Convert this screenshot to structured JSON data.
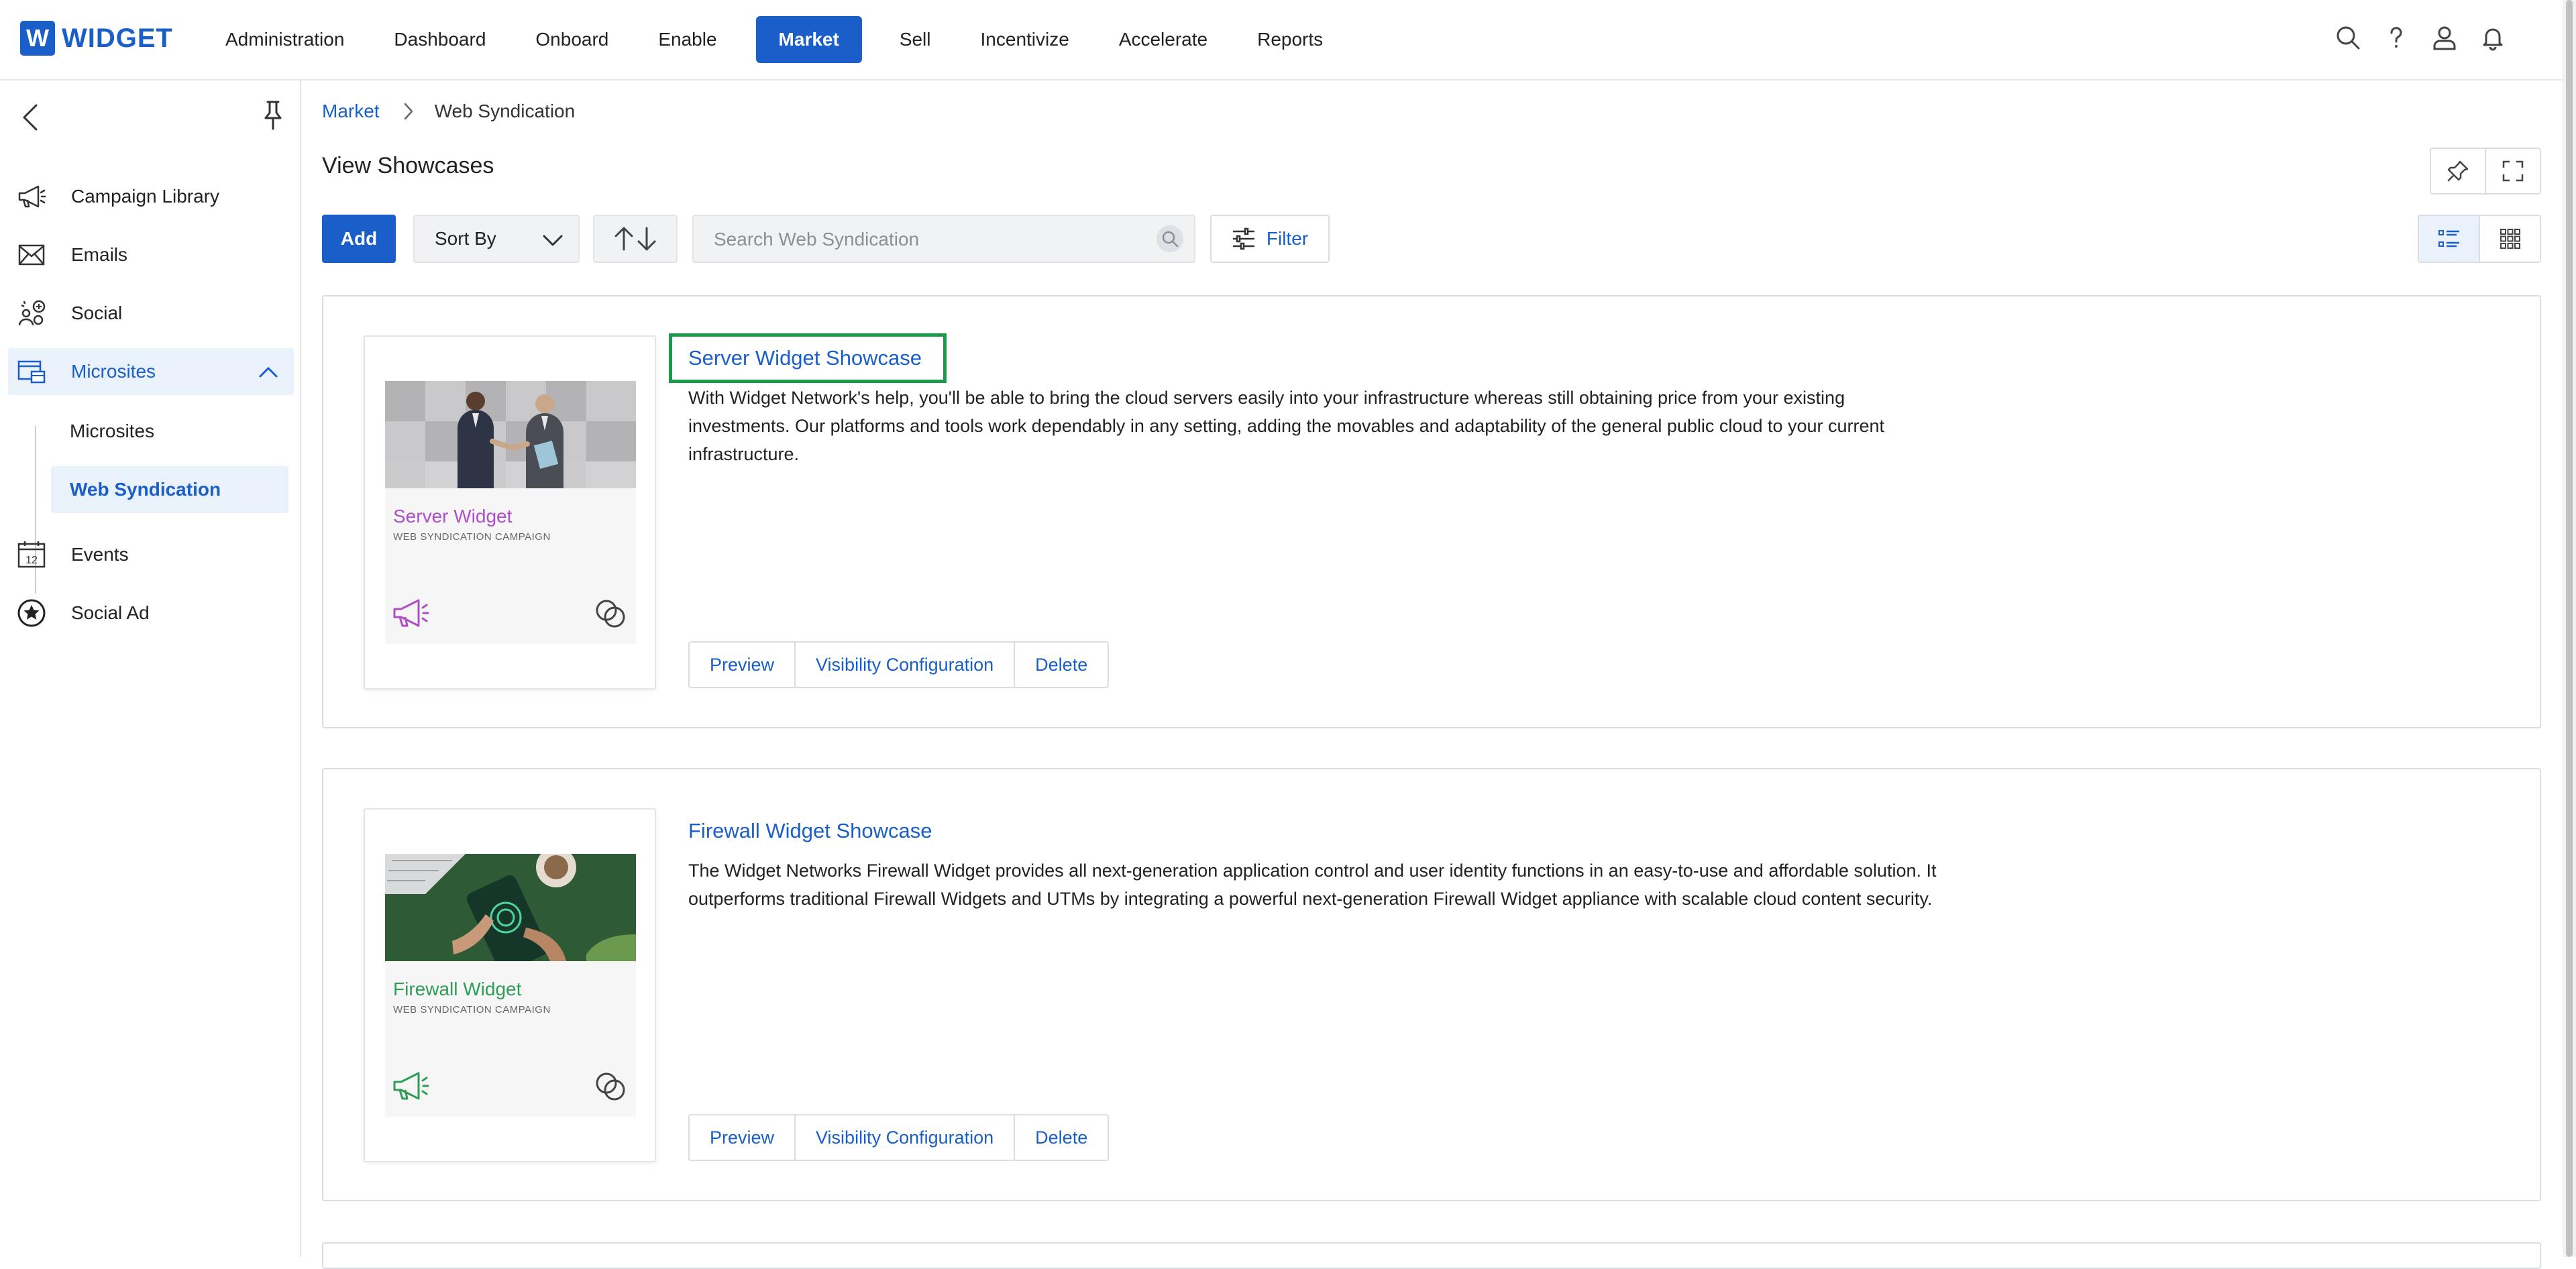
{
  "brand": {
    "logo_letter": "W",
    "name": "WIDGET",
    "accent": "#1a5fc9"
  },
  "nav": {
    "items": [
      {
        "label": "Administration"
      },
      {
        "label": "Dashboard"
      },
      {
        "label": "Onboard"
      },
      {
        "label": "Enable"
      },
      {
        "label": "Market",
        "active": true
      },
      {
        "label": "Sell"
      },
      {
        "label": "Incentivize"
      },
      {
        "label": "Accelerate"
      },
      {
        "label": "Reports"
      }
    ],
    "icons": [
      "search-icon",
      "help-icon",
      "user-icon",
      "bell-icon"
    ]
  },
  "sidebar": {
    "items": [
      {
        "label": "Campaign Library",
        "icon": "megaphone-icon"
      },
      {
        "label": "Emails",
        "icon": "envelope-icon"
      },
      {
        "label": "Social",
        "icon": "social-icon"
      },
      {
        "label": "Microsites",
        "icon": "microsite-icon",
        "expanded": true
      },
      {
        "label": "Events",
        "icon": "calendar-icon"
      },
      {
        "label": "Social Ad",
        "icon": "star-badge-icon"
      }
    ],
    "microsites_sub": [
      {
        "label": "Microsites"
      },
      {
        "label": "Web Syndication",
        "active": true
      }
    ]
  },
  "breadcrumb": {
    "parent": "Market",
    "current": "Web Syndication"
  },
  "page": {
    "title": "View Showcases"
  },
  "toolbar": {
    "add_label": "Add",
    "sort_label": "Sort By",
    "search_placeholder": "Search Web Syndication",
    "filter_label": "Filter"
  },
  "showcases": [
    {
      "title": "Server Widget Showcase",
      "description": "With Widget Network's help, you'll be able to bring the cloud servers easily into your infrastructure whereas still obtaining price from your existing investments. Our platforms and tools work dependably in any setting, adding the movables and adaptability of the general public cloud to your current infrastructure.",
      "thumb_name": "Server Widget",
      "thumb_sub": "WEB SYNDICATION CAMPAIGN",
      "thumb_color": "#b04ec9",
      "highlighted": true,
      "actions": [
        "Preview",
        "Visibility Configuration",
        "Delete"
      ]
    },
    {
      "title": "Firewall Widget Showcase",
      "description": "The Widget Networks Firewall Widget provides all next-generation application control and user identity functions in an easy-to-use and affordable solution. It outperforms traditional Firewall Widgets and UTMs by integrating a powerful next-generation Firewall Widget appliance with scalable cloud content security.",
      "thumb_name": "Firewall Widget",
      "thumb_sub": "WEB SYNDICATION CAMPAIGN",
      "thumb_color": "#2e9e57",
      "highlighted": false,
      "actions": [
        "Preview",
        "Visibility Configuration",
        "Delete"
      ]
    }
  ]
}
